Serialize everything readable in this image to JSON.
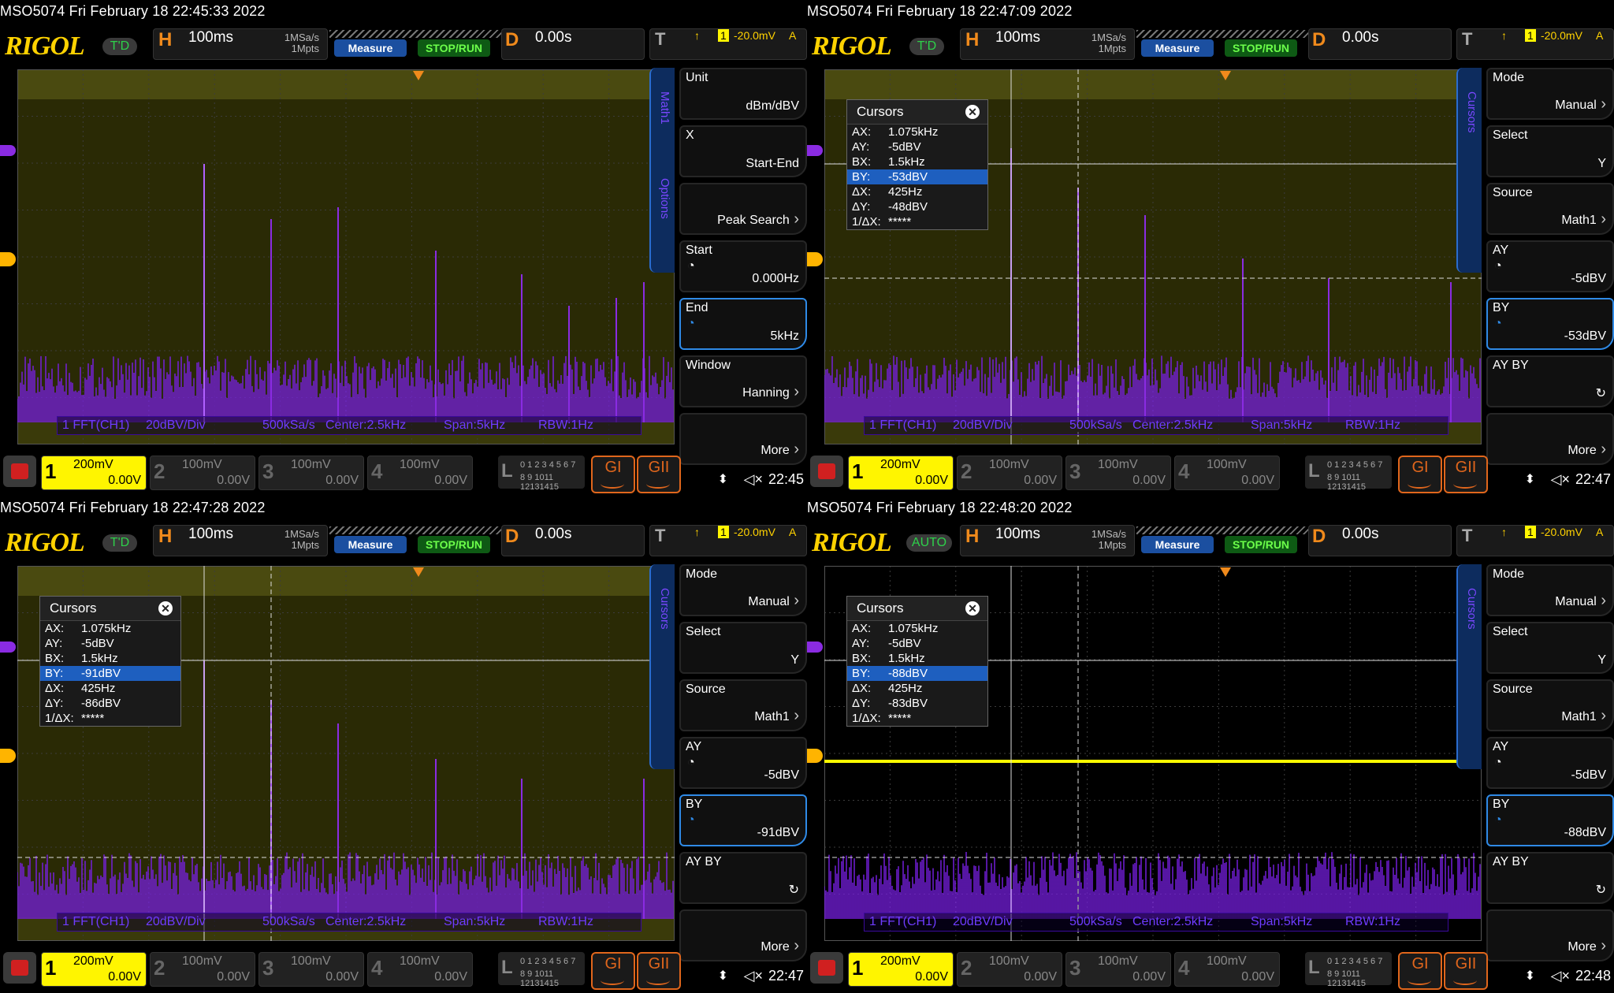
{
  "colors": {
    "trace": "#8a2be2",
    "grid_bg": "#262600",
    "yellow": "#fff500",
    "orange": "#f08a1c"
  },
  "panels": [
    {
      "id": "tl",
      "caption": "MSO5074  Fri February 18 22:45:33 2022",
      "trigger_status": "T'D",
      "h": "100ms",
      "sample": [
        "1MSa/s",
        "1Mpts"
      ],
      "measure": "Measure",
      "stoprun": "STOP/RUN",
      "d": "0.00s",
      "trig_level": "-20.0mV",
      "trig_unit": "A",
      "tab_labels": [
        "Math1",
        "Options"
      ],
      "menu": [
        {
          "label": "Unit",
          "value": "dBm/dBV"
        },
        {
          "label": "X",
          "value": "Start-End"
        },
        {
          "label": "",
          "value": "Peak Search"
        },
        {
          "label": "Start",
          "value": "0.000Hz"
        },
        {
          "label": "End",
          "value": "5kHz",
          "selected": true
        },
        {
          "label": "Window",
          "value": "Hanning"
        },
        {
          "label": "",
          "value": "More"
        }
      ],
      "info": [
        "1 FFT(CH1)",
        "20dBV/Div",
        "500kSa/s",
        "Center:2.5kHz",
        "Span:5kHz",
        "RBW:1Hz"
      ],
      "channels": [
        {
          "n": "1",
          "v": "200mV",
          "o": "0.00V"
        },
        {
          "n": "2",
          "v": "100mV",
          "o": "0.00V"
        },
        {
          "n": "3",
          "v": "100mV",
          "o": "0.00V"
        },
        {
          "n": "4",
          "v": "100mV",
          "o": "0.00V"
        }
      ],
      "logic": [
        "0 1 2 3  4 5 6 7",
        "8 9 1011 12131415"
      ],
      "gen": [
        "GI",
        "GII"
      ],
      "time": "22:45",
      "cursors": null
    },
    {
      "id": "tr",
      "caption": "MSO5074  Fri February 18 22:47:09 2022",
      "trigger_status": "T'D",
      "h": "100ms",
      "sample": [
        "1MSa/s",
        "1Mpts"
      ],
      "measure": "Measure",
      "stoprun": "STOP/RUN",
      "d": "0.00s",
      "trig_level": "-20.0mV",
      "trig_unit": "A",
      "tab_labels": [
        "Cursors"
      ],
      "menu": [
        {
          "label": "Mode",
          "value": "Manual"
        },
        {
          "label": "Select",
          "value": "Y"
        },
        {
          "label": "Source",
          "value": "Math1"
        },
        {
          "label": "AY",
          "value": "-5dBV"
        },
        {
          "label": "BY",
          "value": "-53dBV",
          "selected": true
        },
        {
          "label": "AY BY",
          "value": "↻"
        },
        {
          "label": "",
          "value": "More"
        }
      ],
      "info": [
        "1 FFT(CH1)",
        "20dBV/Div",
        "500kSa/s",
        "Center:2.5kHz",
        "Span:5kHz",
        "RBW:1Hz"
      ],
      "channels": [
        {
          "n": "1",
          "v": "200mV",
          "o": "0.00V"
        },
        {
          "n": "2",
          "v": "100mV",
          "o": "0.00V"
        },
        {
          "n": "3",
          "v": "100mV",
          "o": "0.00V"
        },
        {
          "n": "4",
          "v": "100mV",
          "o": "0.00V"
        }
      ],
      "logic": [
        "0 1 2 3  4 5 6 7",
        "8 9 1011 12131415"
      ],
      "gen": [
        "GI",
        "GII"
      ],
      "time": "22:47",
      "cursors": {
        "title": "Cursors",
        "rows": [
          [
            "AX:",
            "1.075kHz"
          ],
          [
            "AY:",
            "-5dBV"
          ],
          [
            "BX:",
            "1.5kHz"
          ],
          [
            "BY:",
            "-53dBV"
          ],
          [
            "ΔX:",
            "425Hz"
          ],
          [
            "ΔY:",
            "-48dBV"
          ],
          [
            "1/ΔX:",
            "*****"
          ]
        ]
      }
    },
    {
      "id": "bl",
      "caption": "MSO5074  Fri February 18 22:47:28 2022",
      "trigger_status": "T'D",
      "h": "100ms",
      "sample": [
        "1MSa/s",
        "1Mpts"
      ],
      "measure": "Measure",
      "stoprun": "STOP/RUN",
      "d": "0.00s",
      "trig_level": "-20.0mV",
      "trig_unit": "A",
      "tab_labels": [
        "Cursors"
      ],
      "menu": [
        {
          "label": "Mode",
          "value": "Manual"
        },
        {
          "label": "Select",
          "value": "Y"
        },
        {
          "label": "Source",
          "value": "Math1"
        },
        {
          "label": "AY",
          "value": "-5dBV"
        },
        {
          "label": "BY",
          "value": "-91dBV",
          "selected": true
        },
        {
          "label": "AY BY",
          "value": "↻"
        },
        {
          "label": "",
          "value": "More"
        }
      ],
      "info": [
        "1 FFT(CH1)",
        "20dBV/Div",
        "500kSa/s",
        "Center:2.5kHz",
        "Span:5kHz",
        "RBW:1Hz"
      ],
      "channels": [
        {
          "n": "1",
          "v": "200mV",
          "o": "0.00V"
        },
        {
          "n": "2",
          "v": "100mV",
          "o": "0.00V"
        },
        {
          "n": "3",
          "v": "100mV",
          "o": "0.00V"
        },
        {
          "n": "4",
          "v": "100mV",
          "o": "0.00V"
        }
      ],
      "logic": [
        "0 1 2 3  4 5 6 7",
        "8 9 1011 12131415"
      ],
      "gen": [
        "GI",
        "GII"
      ],
      "time": "22:47",
      "cursors": {
        "title": "Cursors",
        "rows": [
          [
            "AX:",
            "1.075kHz"
          ],
          [
            "AY:",
            "-5dBV"
          ],
          [
            "BX:",
            "1.5kHz"
          ],
          [
            "BY:",
            "-91dBV"
          ],
          [
            "ΔX:",
            "425Hz"
          ],
          [
            "ΔY:",
            "-86dBV"
          ],
          [
            "1/ΔX:",
            "*****"
          ]
        ]
      }
    },
    {
      "id": "br",
      "caption": "MSO5074  Fri February 18 22:48:20 2022",
      "trigger_status": "AUTO",
      "h": "100ms",
      "sample": [
        "1MSa/s",
        "1Mpts"
      ],
      "measure": "Measure",
      "stoprun": "STOP/RUN",
      "d": "0.00s",
      "trig_level": "-20.0mV",
      "trig_unit": "A",
      "tab_labels": [
        "Cursors"
      ],
      "menu": [
        {
          "label": "Mode",
          "value": "Manual"
        },
        {
          "label": "Select",
          "value": "Y"
        },
        {
          "label": "Source",
          "value": "Math1"
        },
        {
          "label": "AY",
          "value": "-5dBV"
        },
        {
          "label": "BY",
          "value": "-88dBV",
          "selected": true
        },
        {
          "label": "AY BY",
          "value": "↻"
        },
        {
          "label": "",
          "value": "More"
        }
      ],
      "info": [
        "1 FFT(CH1)",
        "20dBV/Div",
        "500kSa/s",
        "Center:2.5kHz",
        "Span:5kHz",
        "RBW:1Hz"
      ],
      "channels": [
        {
          "n": "1",
          "v": "200mV",
          "o": "0.00V"
        },
        {
          "n": "2",
          "v": "100mV",
          "o": "0.00V"
        },
        {
          "n": "3",
          "v": "100mV",
          "o": "0.00V"
        },
        {
          "n": "4",
          "v": "100mV",
          "o": "0.00V"
        }
      ],
      "logic": [
        "0 1 2 3  4 5 6 7",
        "8 9 1011 12131415"
      ],
      "gen": [
        "GI",
        "GII"
      ],
      "time": "22:48",
      "cursors": {
        "title": "Cursors",
        "rows": [
          [
            "AX:",
            "1.075kHz"
          ],
          [
            "AY:",
            "-5dBV"
          ],
          [
            "BX:",
            "1.5kHz"
          ],
          [
            "BY:",
            "-88dBV"
          ],
          [
            "ΔX:",
            "425Hz"
          ],
          [
            "ΔY:",
            "-83dBV"
          ],
          [
            "1/ΔX:",
            "*****"
          ]
        ]
      }
    }
  ]
}
